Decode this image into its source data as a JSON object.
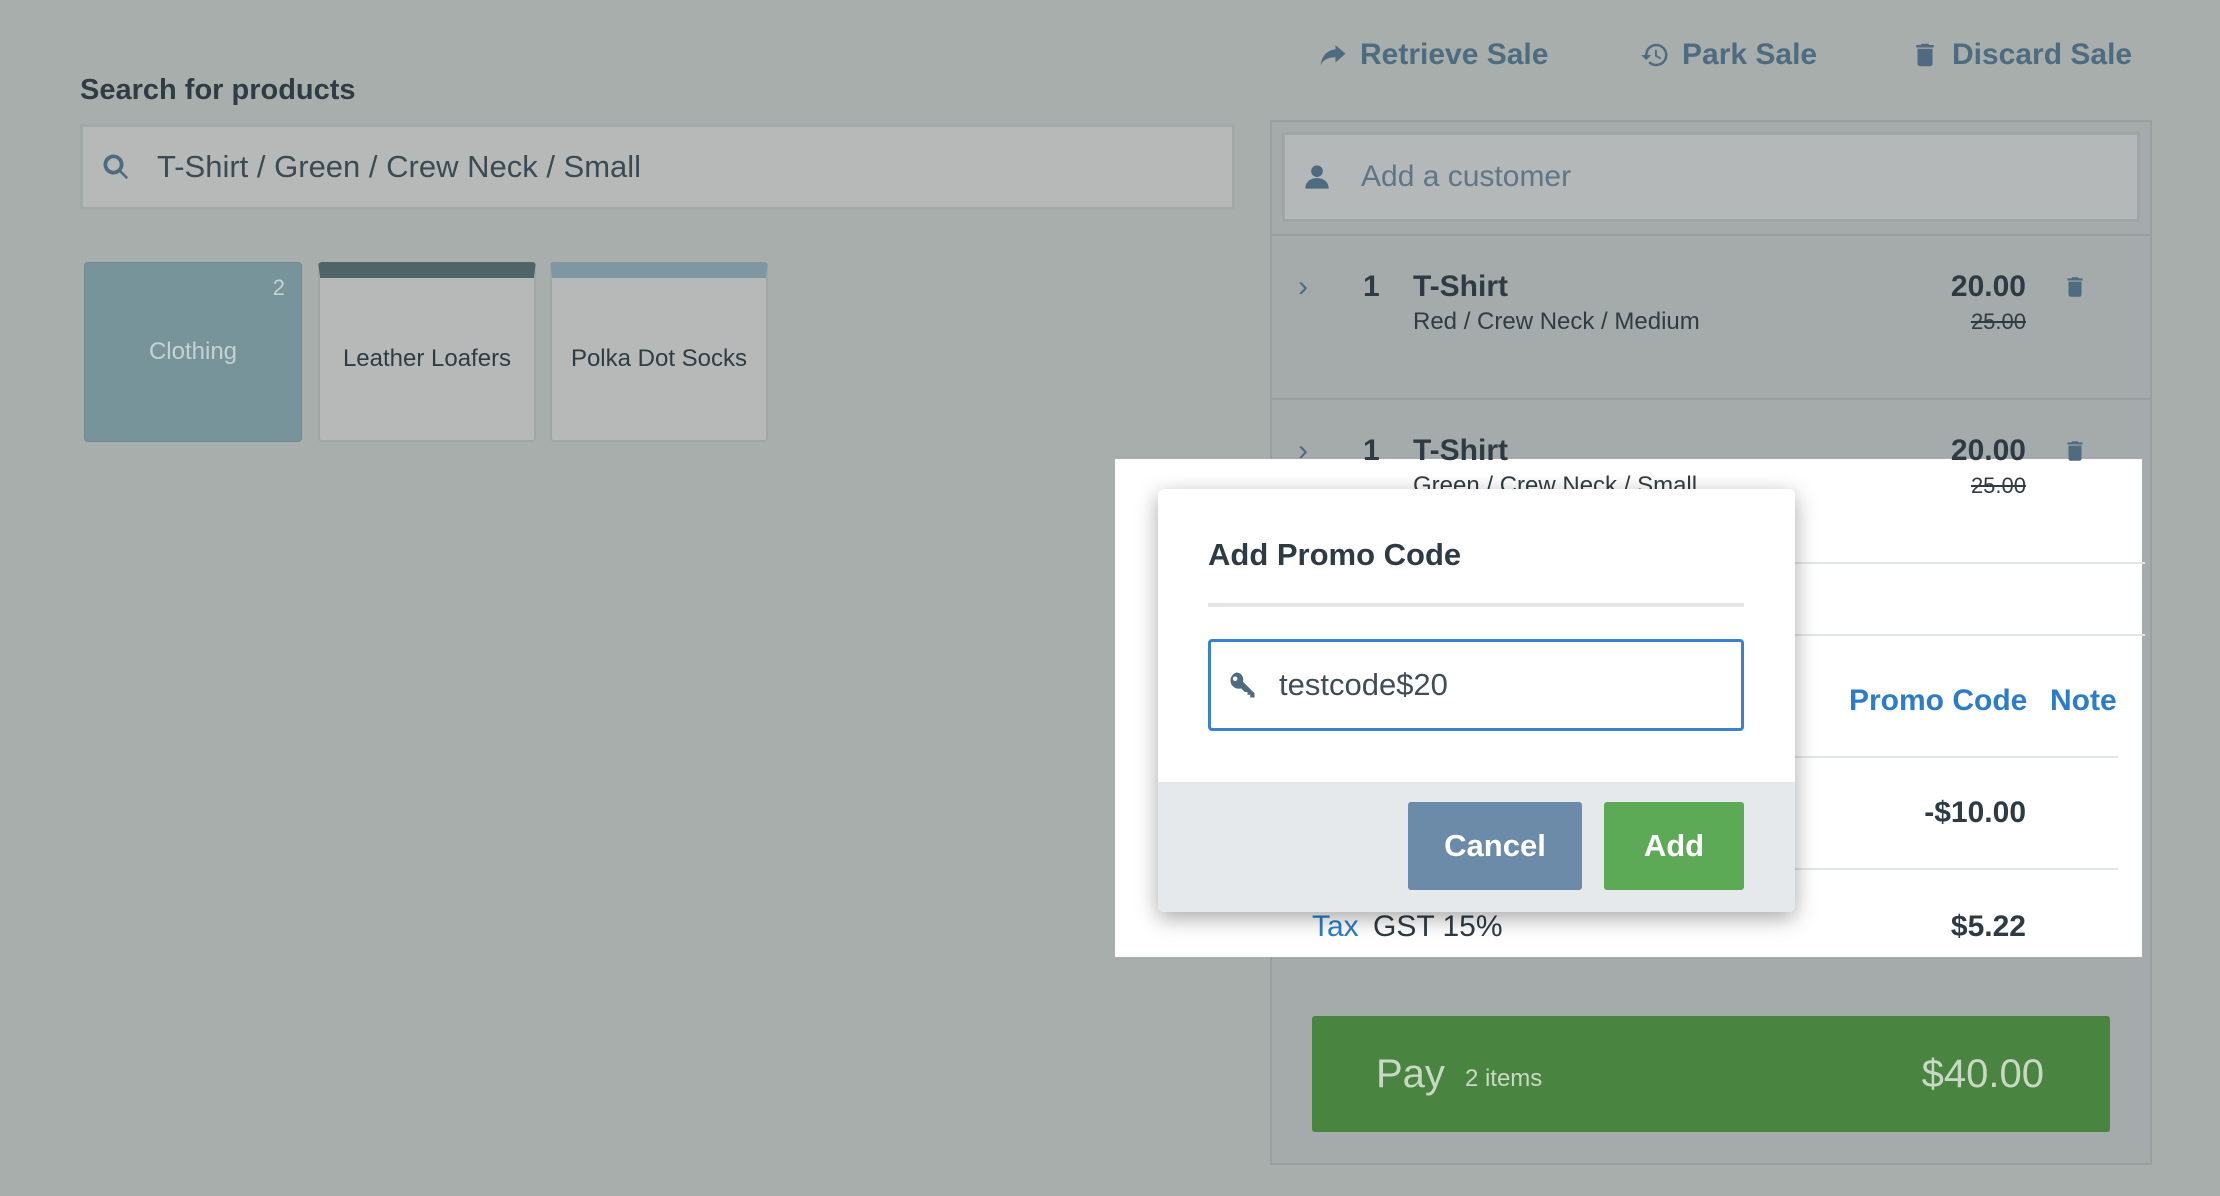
{
  "top_actions": {
    "retrieve": "Retrieve Sale",
    "park": "Park Sale",
    "discard": "Discard Sale"
  },
  "search": {
    "label": "Search for products",
    "value": "T-Shirt / Green / Crew Neck / Small"
  },
  "tiles": {
    "clothing": {
      "label": "Clothing",
      "count": "2"
    },
    "loafers": {
      "label": "Leather Loafers"
    },
    "socks": {
      "label": "Polka Dot Socks"
    }
  },
  "customer": {
    "placeholder": "Add a customer"
  },
  "line_items": [
    {
      "qty": "1",
      "name": "T-Shirt",
      "variant": "Red / Crew Neck / Medium",
      "price": "20.00",
      "original_price": "25.00"
    },
    {
      "qty": "1",
      "name": "T-Shirt",
      "variant": "Green / Crew Neck / Small",
      "price": "20.00",
      "original_price": "25.00"
    }
  ],
  "sale_actions": {
    "promo_code": "Promo Code",
    "note": "Note"
  },
  "summary": {
    "discount": "-$10.00",
    "tax_label": "Tax",
    "tax_name": "GST 15%",
    "tax_value": "$5.22"
  },
  "pay": {
    "label": "Pay",
    "items": "2 items",
    "total": "$40.00"
  },
  "modal": {
    "title": "Add Promo Code",
    "input_value": "testcode$20",
    "cancel": "Cancel",
    "add": "Add"
  },
  "colors": {
    "accent_blue": "#2d7cc9",
    "pay_green": "#4a8441",
    "add_green": "#5caa55",
    "cancel_blue": "#6b8ba8"
  }
}
